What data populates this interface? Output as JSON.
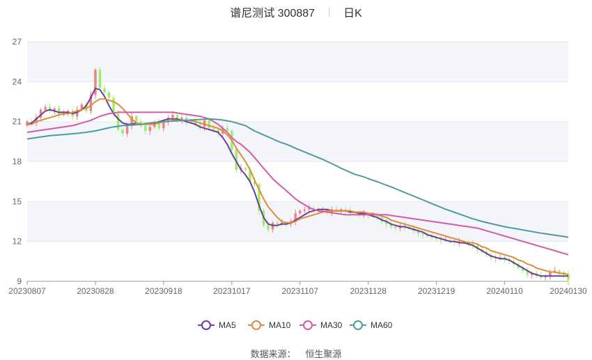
{
  "header": {
    "title": "谱尼测试 300887",
    "period": "日K"
  },
  "source": {
    "label": "数据来源：",
    "value": "恒生聚源"
  },
  "chart_data": {
    "type": "candlestick",
    "ylim": [
      9,
      27
    ],
    "yticks": [
      9,
      12,
      15,
      18,
      21,
      24,
      27
    ],
    "xtick_labels": [
      "20230807",
      "20230828",
      "20230918",
      "20231017",
      "20231107",
      "20231128",
      "20231219",
      "20240110",
      "20240130"
    ],
    "xtick_index": [
      0,
      15,
      30,
      45,
      60,
      75,
      90,
      105,
      119
    ],
    "grid": "horizontal-bands",
    "legend_position": "bottom",
    "up_color": "#f07f7f",
    "down_color": "#9bef62",
    "close": [
      21.0,
      20.9,
      21.3,
      21.9,
      22.1,
      21.8,
      22.0,
      21.5,
      21.6,
      21.8,
      21.4,
      21.9,
      22.3,
      21.8,
      23.0,
      24.9,
      23.5,
      23.2,
      22.8,
      21.6,
      20.4,
      20.1,
      20.7,
      21.4,
      21.0,
      20.7,
      20.3,
      20.6,
      20.9,
      20.5,
      21.0,
      21.3,
      21.5,
      21.1,
      21.3,
      21.0,
      21.1,
      20.8,
      20.6,
      21.1,
      20.5,
      20.4,
      20.1,
      20.5,
      20.3,
      18.9,
      17.4,
      17.5,
      17.4,
      16.5,
      16.3,
      14.3,
      13.2,
      12.9,
      13.4,
      13.3,
      13.4,
      13.3,
      13.5,
      14.1,
      14.3,
      14.4,
      14.5,
      14.4,
      14.3,
      14.3,
      14.2,
      14.4,
      14.3,
      14.4,
      14.3,
      14.2,
      14.1,
      14.0,
      14.1,
      14.0,
      13.9,
      13.8,
      13.5,
      13.3,
      13.1,
      13.0,
      13.2,
      13.1,
      13.0,
      12.8,
      12.6,
      12.5,
      12.4,
      12.3,
      12.2,
      12.1,
      12.1,
      12.0,
      11.9,
      12.0,
      11.9,
      11.8,
      11.7,
      11.4,
      11.2,
      11.0,
      10.8,
      10.7,
      10.8,
      10.6,
      10.5,
      10.3,
      10.0,
      9.8,
      9.5,
      9.6,
      9.4,
      9.3,
      9.4,
      9.7,
      9.8,
      9.6,
      9.5,
      9.1
    ],
    "series": [
      {
        "name": "MA5",
        "color": "#6a3ea1",
        "values": [
          20.8,
          20.9,
          21.2,
          21.5,
          21.8,
          21.9,
          21.8,
          21.7,
          21.7,
          21.7,
          21.6,
          21.7,
          21.9,
          22.2,
          22.8,
          23.5,
          23.4,
          22.9,
          22.2,
          21.6,
          21.2,
          20.9,
          20.8,
          20.8,
          20.9,
          20.8,
          20.8,
          20.8,
          20.9,
          21.0,
          21.1,
          21.2,
          21.2,
          21.2,
          21.1,
          21.0,
          20.9,
          20.8,
          20.6,
          20.5,
          20.4,
          20.3,
          20.2,
          19.8,
          19.3,
          18.6,
          18.0,
          17.4,
          17.0,
          16.5,
          15.7,
          14.7,
          13.8,
          13.3,
          13.2,
          13.2,
          13.3,
          13.3,
          13.4,
          13.6,
          13.8,
          14.0,
          14.2,
          14.3,
          14.4,
          14.4,
          14.4,
          14.3,
          14.3,
          14.3,
          14.3,
          14.2,
          14.2,
          14.1,
          14.1,
          14.0,
          13.9,
          13.8,
          13.6,
          13.5,
          13.3,
          13.2,
          13.1,
          13.1,
          13.0,
          12.9,
          12.8,
          12.7,
          12.5,
          12.4,
          12.3,
          12.2,
          12.1,
          12.0,
          12.0,
          11.9,
          11.9,
          11.8,
          11.7,
          11.5,
          11.3,
          11.1,
          10.9,
          10.8,
          10.7,
          10.7,
          10.6,
          10.4,
          10.2,
          10.0,
          9.8,
          9.6,
          9.5,
          9.4,
          9.4,
          9.4,
          9.4,
          9.4,
          9.4,
          9.4
        ]
      },
      {
        "name": "MA10",
        "color": "#e08a3a",
        "values": [
          20.8,
          20.8,
          21.0,
          21.1,
          21.2,
          21.3,
          21.4,
          21.5,
          21.6,
          21.6,
          21.7,
          21.8,
          21.9,
          22.0,
          22.2,
          22.5,
          22.7,
          22.7,
          22.6,
          22.5,
          22.3,
          22.0,
          21.6,
          21.2,
          20.9,
          20.8,
          20.8,
          20.8,
          20.8,
          20.9,
          21.0,
          21.0,
          21.1,
          21.1,
          21.1,
          21.1,
          21.1,
          21.0,
          20.9,
          20.8,
          20.7,
          20.6,
          20.5,
          20.3,
          20.0,
          19.6,
          19.0,
          18.5,
          18.0,
          17.4,
          16.6,
          15.9,
          15.2,
          14.6,
          14.2,
          13.8,
          13.5,
          13.4,
          13.4,
          13.5,
          13.7,
          13.8,
          13.9,
          14.0,
          14.1,
          14.2,
          14.3,
          14.3,
          14.3,
          14.3,
          14.3,
          14.3,
          14.2,
          14.2,
          14.2,
          14.1,
          14.1,
          14.0,
          13.9,
          13.8,
          13.6,
          13.5,
          13.4,
          13.3,
          13.2,
          13.1,
          13.0,
          12.9,
          12.8,
          12.7,
          12.6,
          12.5,
          12.4,
          12.3,
          12.2,
          12.1,
          12.0,
          11.9,
          11.9,
          11.8,
          11.6,
          11.5,
          11.3,
          11.2,
          11.1,
          11.0,
          10.9,
          10.8,
          10.6,
          10.5,
          10.3,
          10.2,
          10.0,
          9.9,
          9.8,
          9.7,
          9.7,
          9.6,
          9.6,
          9.5
        ]
      },
      {
        "name": "MA30",
        "color": "#d25aa7",
        "values": [
          20.2,
          20.25,
          20.3,
          20.35,
          20.4,
          20.45,
          20.5,
          20.55,
          20.6,
          20.65,
          20.7,
          20.8,
          20.9,
          21.0,
          21.1,
          21.25,
          21.4,
          21.5,
          21.6,
          21.65,
          21.7,
          21.7,
          21.7,
          21.7,
          21.7,
          21.7,
          21.7,
          21.7,
          21.7,
          21.7,
          21.7,
          21.7,
          21.7,
          21.65,
          21.6,
          21.55,
          21.5,
          21.45,
          21.4,
          21.3,
          21.2,
          21.0,
          20.8,
          20.5,
          20.2,
          19.8,
          19.5,
          19.3,
          19.0,
          18.7,
          18.3,
          17.9,
          17.5,
          17.1,
          16.7,
          16.4,
          16.1,
          15.8,
          15.5,
          15.2,
          14.95,
          14.75,
          14.55,
          14.4,
          14.3,
          14.25,
          14.2,
          14.15,
          14.1,
          14.05,
          14.0,
          14.0,
          14.0,
          14.0,
          14.0,
          14.0,
          14.0,
          14.0,
          14.0,
          14.0,
          13.95,
          13.9,
          13.85,
          13.8,
          13.75,
          13.7,
          13.65,
          13.6,
          13.55,
          13.5,
          13.45,
          13.4,
          13.35,
          13.3,
          13.25,
          13.2,
          13.15,
          13.1,
          13.05,
          13.0,
          12.9,
          12.8,
          12.7,
          12.6,
          12.5,
          12.4,
          12.3,
          12.2,
          12.1,
          12.0,
          11.9,
          11.8,
          11.7,
          11.6,
          11.5,
          11.4,
          11.3,
          11.2,
          11.1,
          11.0
        ]
      },
      {
        "name": "MA60",
        "color": "#4e9a9c",
        "values": [
          19.7,
          19.75,
          19.8,
          19.85,
          19.9,
          19.95,
          19.98,
          20.0,
          20.03,
          20.06,
          20.09,
          20.12,
          20.16,
          20.2,
          20.25,
          20.3,
          20.38,
          20.46,
          20.54,
          20.6,
          20.65,
          20.7,
          20.72,
          20.74,
          20.77,
          20.8,
          20.85,
          20.9,
          20.93,
          20.96,
          21.0,
          21.02,
          21.04,
          21.06,
          21.08,
          21.1,
          21.12,
          21.14,
          21.16,
          21.18,
          21.2,
          21.18,
          21.16,
          21.12,
          21.06,
          21.0,
          20.9,
          20.8,
          20.7,
          20.5,
          20.3,
          20.15,
          20.0,
          19.85,
          19.7,
          19.55,
          19.42,
          19.3,
          19.16,
          19.0,
          18.86,
          18.72,
          18.58,
          18.44,
          18.3,
          18.16,
          18.0,
          17.84,
          17.68,
          17.5,
          17.35,
          17.2,
          17.05,
          16.95,
          16.85,
          16.72,
          16.6,
          16.48,
          16.35,
          16.22,
          16.1,
          15.96,
          15.82,
          15.68,
          15.54,
          15.4,
          15.26,
          15.12,
          14.98,
          14.84,
          14.7,
          14.56,
          14.42,
          14.3,
          14.18,
          14.06,
          13.94,
          13.82,
          13.7,
          13.6,
          13.5,
          13.42,
          13.34,
          13.26,
          13.18,
          13.1,
          13.04,
          12.98,
          12.92,
          12.86,
          12.8,
          12.74,
          12.68,
          12.62,
          12.57,
          12.52,
          12.47,
          12.42,
          12.37,
          12.32
        ]
      }
    ]
  }
}
